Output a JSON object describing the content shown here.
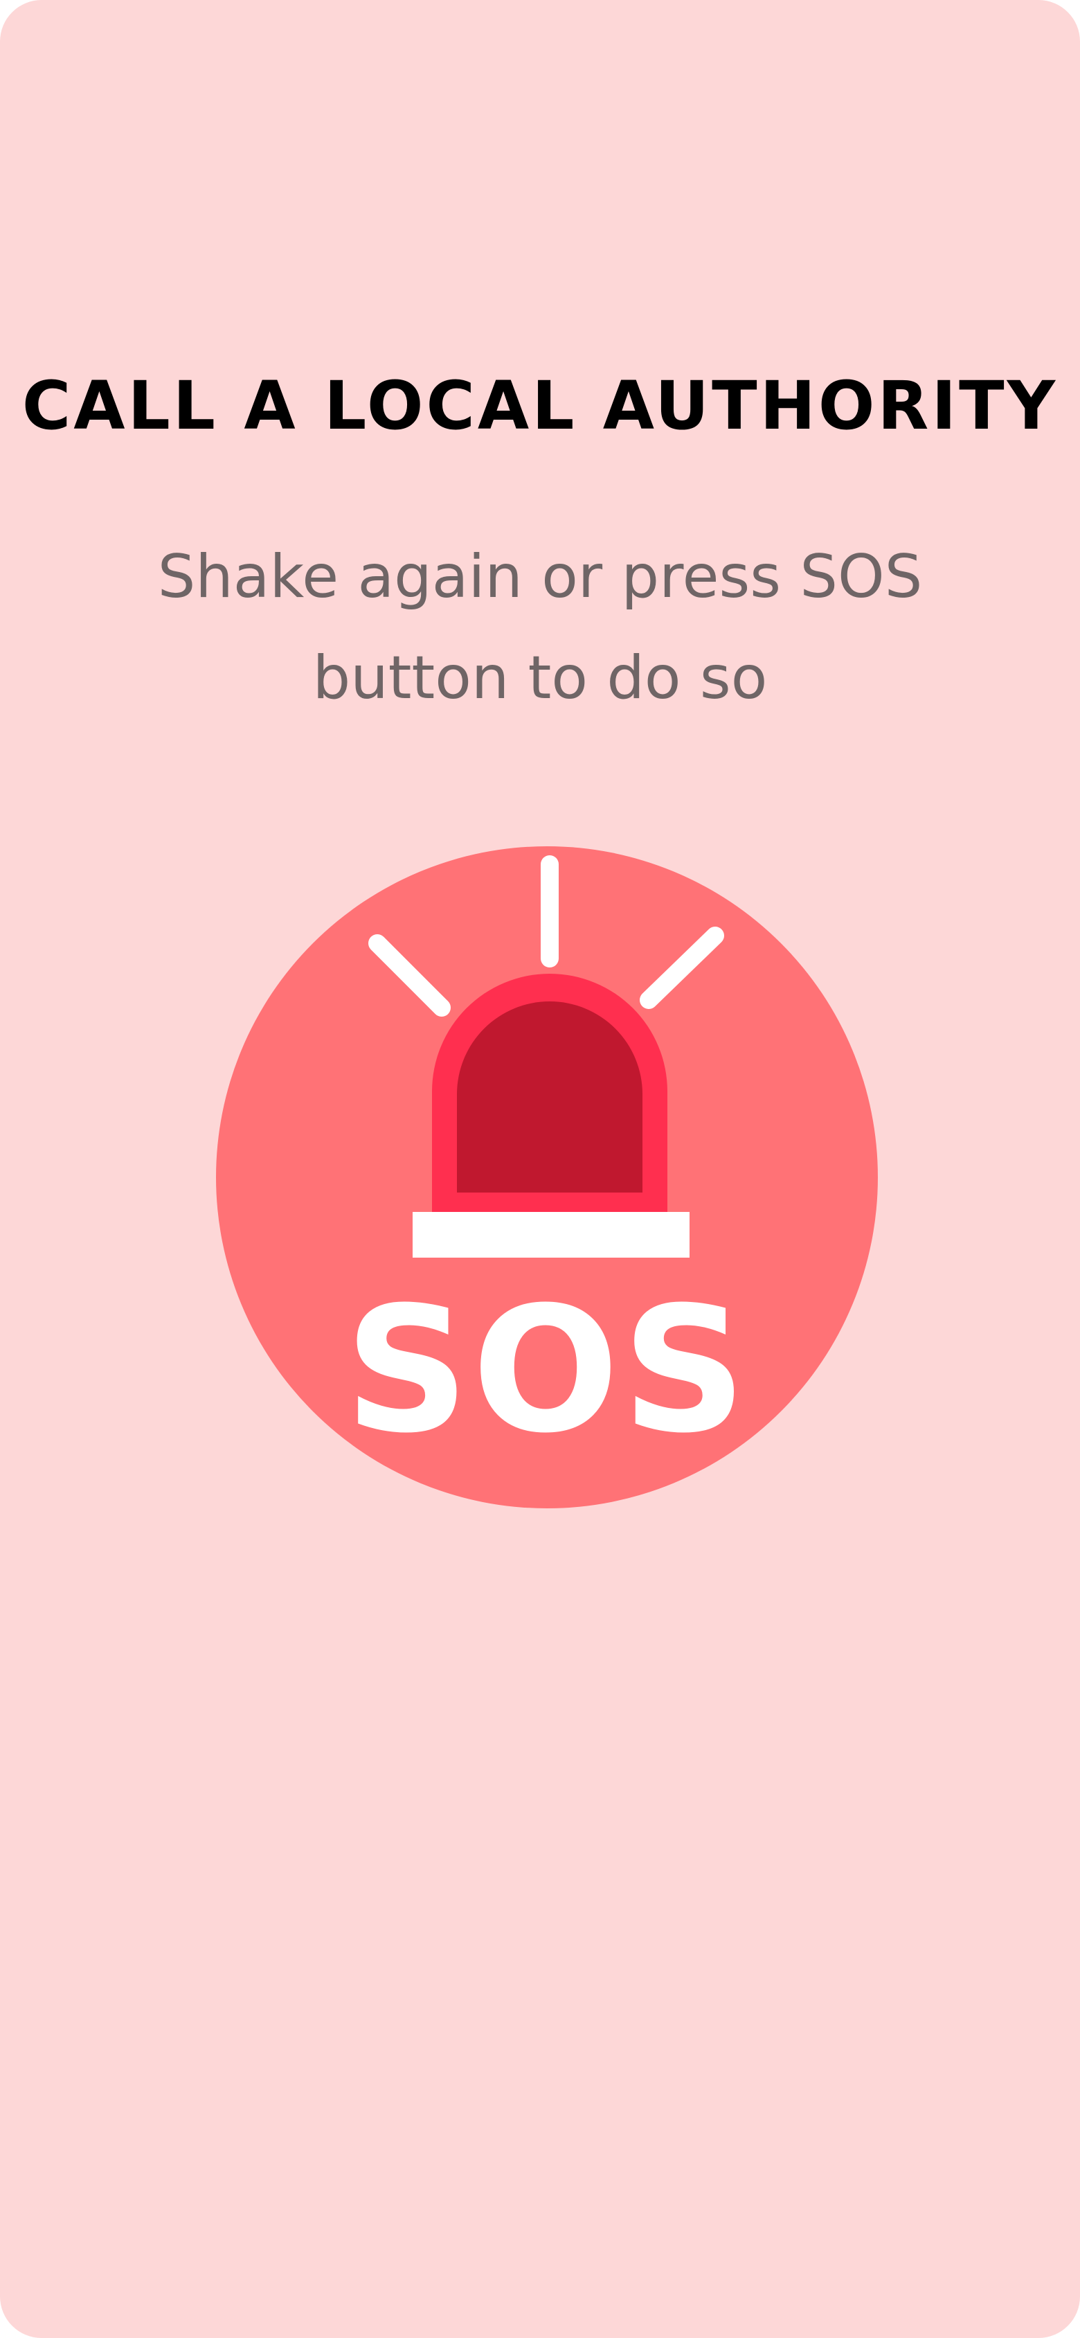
{
  "screen": {
    "title": "CALL A LOCAL AUTHORITY",
    "subtitle_line1": "Shake again or press SOS",
    "subtitle_line2": "button to do so"
  },
  "sos_button": {
    "label": "SOS",
    "icon": "siren-icon"
  },
  "colors": {
    "background": "#fdd7d7",
    "circle": "#ff7276",
    "siren_outer": "#ff2f4f",
    "siren_inner": "#c0182f",
    "white": "#ffffff",
    "title": "#000000",
    "subtitle": "#6f6566"
  }
}
